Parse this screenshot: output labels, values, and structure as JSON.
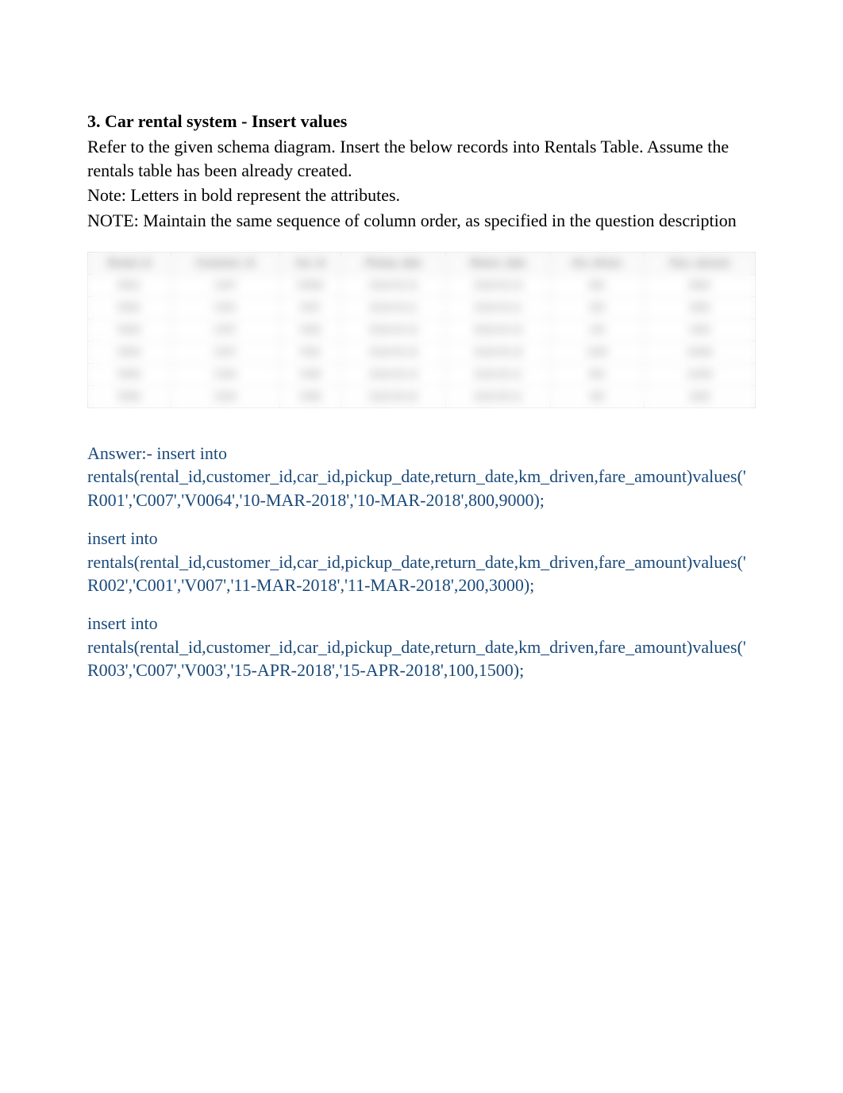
{
  "heading": "3. Car rental system - Insert values",
  "intro_para_1": "Refer to the given schema diagram. Insert the below records into Rentals Table. Assume the rentals table has been already created.",
  "intro_para_2": "Note: Letters in bold represent the attributes.",
  "intro_para_3": "NOTE: Maintain the same sequence of column order, as specified in the question description",
  "table_headers": [
    "Rental_id",
    "Customer_id",
    "Car_id",
    "Pickup_date",
    "Return_date",
    "Km_driven",
    "Fare_amount"
  ],
  "table_rows": [
    [
      "R001",
      "C007",
      "V0064",
      "2018-03-10",
      "2018-03-10",
      "800",
      "9000"
    ],
    [
      "R002",
      "C001",
      "V007",
      "2018-03-11",
      "2018-03-11",
      "200",
      "3000"
    ],
    [
      "R003",
      "C007",
      "V003",
      "2018-04-15",
      "2018-04-15",
      "100",
      "1500"
    ],
    [
      "R004",
      "C007",
      "V001",
      "2018-05-16",
      "2018-05-16",
      "1000",
      "10000"
    ],
    [
      "R005",
      "C004",
      "V005",
      "2018-05-10",
      "2018-05-11",
      "900",
      "11000"
    ],
    [
      "R006",
      "C004",
      "V006",
      "2018-05-20",
      "2018-05-21",
      "200",
      "2500"
    ]
  ],
  "answers": [
    "Answer:- insert into rentals(rental_id,customer_id,car_id,pickup_date,return_date,km_driven,fare_amount)values('R001','C007','V0064','10-MAR-2018','10-MAR-2018',800,9000);",
    "insert into rentals(rental_id,customer_id,car_id,pickup_date,return_date,km_driven,fare_amount)values('R002','C001','V007','11-MAR-2018','11-MAR-2018',200,3000);",
    "insert into rentals(rental_id,customer_id,car_id,pickup_date,return_date,km_driven,fare_amount)values('R003','C007','V003','15-APR-2018','15-APR-2018',100,1500);"
  ]
}
